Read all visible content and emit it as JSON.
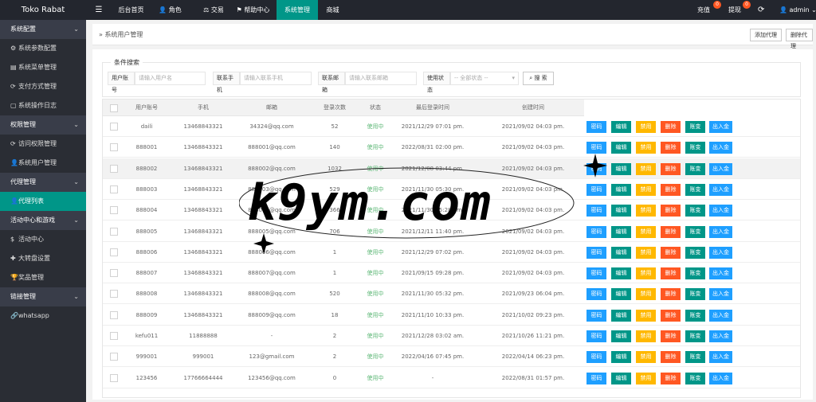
{
  "brand": "Toko Rabat",
  "topnav": [
    {
      "label": "后台首页",
      "icon": "home-icon"
    },
    {
      "label": "角色",
      "icon": "user-icon"
    },
    {
      "label": "交易",
      "icon": "balance-icon"
    },
    {
      "label": "帮助中心",
      "icon": "flag-icon"
    },
    {
      "label": "系统管理",
      "icon": ""
    },
    {
      "label": "商城",
      "icon": ""
    }
  ],
  "topright": {
    "recharge": "充值",
    "recharge_badge": "0",
    "withdraw": "提现",
    "withdraw_badge": "0",
    "user": "admin"
  },
  "sidebar": {
    "groups": [
      {
        "label": "系统配置",
        "items": [
          {
            "label": "系统参数配置",
            "icon": "gear-icon"
          },
          {
            "label": "系统菜单管理",
            "icon": "menu-icon"
          },
          {
            "label": "支付方式管理",
            "icon": "refresh-icon"
          },
          {
            "label": "系统操作日志",
            "icon": "doc-icon"
          }
        ]
      },
      {
        "label": "权限管理",
        "items": [
          {
            "label": "访问权限管理",
            "icon": "refresh-icon"
          },
          {
            "label": "系统用户管理",
            "icon": "user-icon"
          }
        ]
      },
      {
        "label": "代理管理",
        "items": [
          {
            "label": "代理列表",
            "icon": "user-icon"
          }
        ]
      },
      {
        "label": "活动中心和游戏",
        "items": [
          {
            "label": "活动中心",
            "icon": "dollar-icon"
          },
          {
            "label": "大转盘设置",
            "icon": "wheel-icon"
          },
          {
            "label": "奖品管理",
            "icon": "trophy-icon"
          }
        ]
      },
      {
        "label": "链接管理",
        "items": [
          {
            "label": "whatsapp",
            "icon": "link-icon"
          }
        ]
      }
    ]
  },
  "breadcrumb": "系统用户管理",
  "header_buttons": {
    "add": "添加代理",
    "delete": "删除代理"
  },
  "filter": {
    "legend": "条件搜索",
    "account_label": "用户账号",
    "account_placeholder": "请输入用户名",
    "phone_label": "联系手机",
    "phone_placeholder": "请输入联系手机",
    "email_label": "联系邮箱",
    "email_placeholder": "请输入联系邮箱",
    "status_label": "使用状态",
    "status_value": "-- 全部状态 --",
    "search_label": "搜 索"
  },
  "table": {
    "columns": [
      "用户账号",
      "手机",
      "邮箱",
      "登录次数",
      "状态",
      "最后登录时间",
      "创建时间"
    ],
    "actions": [
      "密码",
      "编辑",
      "禁用",
      "删除",
      "账变",
      "出入金"
    ],
    "rows": [
      {
        "account": "daili",
        "phone": "13468843321",
        "email": "34324@qq.com",
        "logins": "52",
        "status": "使用中",
        "last": "2021/12/29 07:01 pm.",
        "created": "2021/09/02 04:03 pm."
      },
      {
        "account": "888001",
        "phone": "13468843321",
        "email": "888001@qq.com",
        "logins": "140",
        "status": "使用中",
        "last": "2022/08/31 02:00 pm.",
        "created": "2021/09/02 04:03 pm."
      },
      {
        "account": "888002",
        "phone": "13468843321",
        "email": "888002@qq.com",
        "logins": "1032",
        "status": "使用中",
        "last": "2021/12/08 03:44 pm.",
        "created": "2021/09/02 04:03 pm."
      },
      {
        "account": "888003",
        "phone": "13468843321",
        "email": "888003@qq.com",
        "logins": "529",
        "status": "使用中",
        "last": "2021/11/30 05:30 pm.",
        "created": "2021/09/02 04:03 pm."
      },
      {
        "account": "888004",
        "phone": "13468843321",
        "email": "888004@qq.com",
        "logins": "366",
        "status": "使用中",
        "last": "2021/11/30 05:28 pm.",
        "created": "2021/09/02 04:03 pm."
      },
      {
        "account": "888005",
        "phone": "13468843321",
        "email": "888005@qq.com",
        "logins": "706",
        "status": "使用中",
        "last": "2021/12/11 11:40 pm.",
        "created": "2021/09/02 04:03 pm."
      },
      {
        "account": "888006",
        "phone": "13468843321",
        "email": "888006@qq.com",
        "logins": "1",
        "status": "使用中",
        "last": "2021/12/29 07:02 pm.",
        "created": "2021/09/02 04:03 pm."
      },
      {
        "account": "888007",
        "phone": "13468843321",
        "email": "888007@qq.com",
        "logins": "1",
        "status": "使用中",
        "last": "2021/09/15 09:28 pm.",
        "created": "2021/09/02 04:03 pm."
      },
      {
        "account": "888008",
        "phone": "13468843321",
        "email": "888008@qq.com",
        "logins": "520",
        "status": "使用中",
        "last": "2021/11/30 05:32 pm.",
        "created": "2021/09/23 06:04 pm."
      },
      {
        "account": "888009",
        "phone": "13468843321",
        "email": "888009@qq.com",
        "logins": "18",
        "status": "使用中",
        "last": "2021/11/10 10:33 pm.",
        "created": "2021/10/02 09:23 pm."
      },
      {
        "account": "kefu011",
        "phone": "11888888",
        "email": "-",
        "logins": "2",
        "status": "使用中",
        "last": "2021/12/28 03:02 am.",
        "created": "2021/10/26 11:21 pm."
      },
      {
        "account": "999001",
        "phone": "999001",
        "email": "123@gmail.com",
        "logins": "2",
        "status": "使用中",
        "last": "2022/04/16 07:45 pm.",
        "created": "2022/04/14 06:23 pm."
      },
      {
        "account": "123456",
        "phone": "17766664444",
        "email": "123456@qq.com",
        "logins": "0",
        "status": "使用中",
        "last": "-",
        "created": "2022/08/31 01:57 pm."
      }
    ]
  },
  "watermark": "k9ym.com"
}
